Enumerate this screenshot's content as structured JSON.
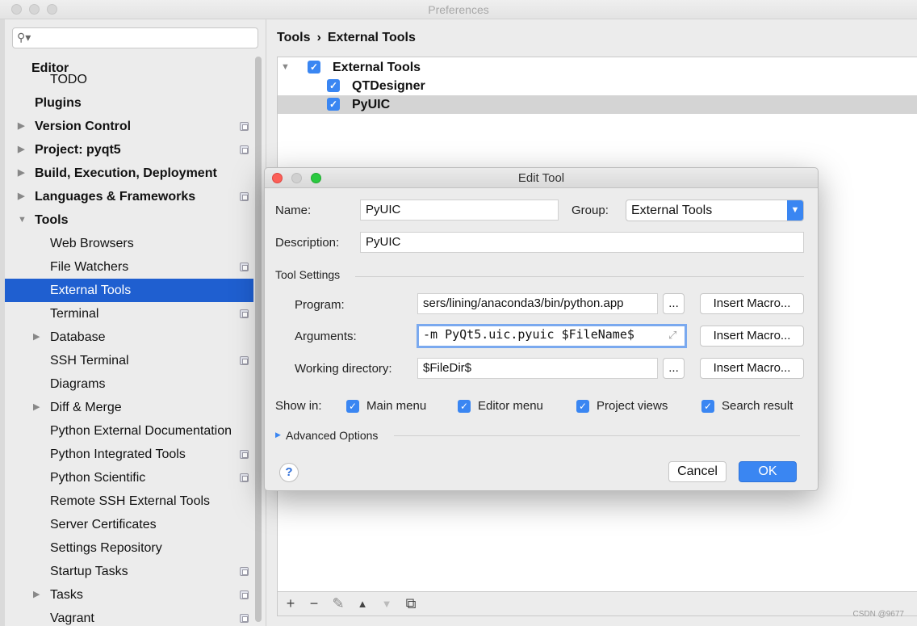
{
  "window": {
    "title": "Preferences"
  },
  "search": {
    "placeholder": ""
  },
  "sidebar": {
    "items": [
      {
        "label": "Editor",
        "bold": true
      },
      {
        "label": "TODO"
      },
      {
        "label": "Plugins",
        "bold": true
      },
      {
        "label": "Version Control",
        "bold": true
      },
      {
        "label": "Project: pyqt5",
        "bold": true
      },
      {
        "label": "Build, Execution, Deployment",
        "bold": true
      },
      {
        "label": "Languages & Frameworks",
        "bold": true
      },
      {
        "label": "Tools",
        "bold": true
      },
      {
        "label": "Web Browsers"
      },
      {
        "label": "File Watchers"
      },
      {
        "label": "External Tools",
        "selected": true
      },
      {
        "label": "Terminal"
      },
      {
        "label": "Database"
      },
      {
        "label": "SSH Terminal"
      },
      {
        "label": "Diagrams"
      },
      {
        "label": "Diff & Merge"
      },
      {
        "label": "Python External Documentation"
      },
      {
        "label": "Python Integrated Tools"
      },
      {
        "label": "Python Scientific"
      },
      {
        "label": "Remote SSH External Tools"
      },
      {
        "label": "Server Certificates"
      },
      {
        "label": "Settings Repository"
      },
      {
        "label": "Startup Tasks"
      },
      {
        "label": "Tasks"
      },
      {
        "label": "Vagrant"
      }
    ]
  },
  "breadcrumb": {
    "parent": "Tools",
    "separator": "›",
    "current": "External Tools"
  },
  "tool_list": {
    "items": [
      {
        "label": "External Tools",
        "checked": true,
        "expanded": true
      },
      {
        "label": "QTDesigner",
        "checked": true
      },
      {
        "label": "PyUIC",
        "checked": true,
        "selected": true
      }
    ]
  },
  "toolbar": {
    "add": "+",
    "remove": "−",
    "edit": "✎",
    "up": "▲",
    "down": "▼",
    "copy": "⧉"
  },
  "dialog": {
    "title": "Edit Tool",
    "name_label": "Name:",
    "name_value": "PyUIC",
    "group_label": "Group:",
    "group_value": "External Tools",
    "description_label": "Description:",
    "description_value": "PyUIC",
    "tool_settings_label": "Tool Settings",
    "program_label": "Program:",
    "program_value": "sers/lining/anaconda3/bin/python.app",
    "arguments_label": "Arguments:",
    "arguments_value": "-m PyQt5.uic.pyuic  $FileName$",
    "workdir_label": "Working directory:",
    "workdir_value": "$FileDir$",
    "browse_label": "...",
    "insert_macro_label": "Insert Macro...",
    "show_in_label": "Show in:",
    "show_in": [
      {
        "label": "Main menu",
        "checked": true
      },
      {
        "label": "Editor menu",
        "checked": true
      },
      {
        "label": "Project views",
        "checked": true
      },
      {
        "label": "Search result",
        "checked": true
      }
    ],
    "advanced_label": "Advanced Options",
    "help_label": "?",
    "cancel_label": "Cancel",
    "ok_label": "OK"
  },
  "watermark": "CSDN @9677",
  "colors": {
    "accent": "#3a86f2",
    "selection": "#1f5fd0"
  }
}
